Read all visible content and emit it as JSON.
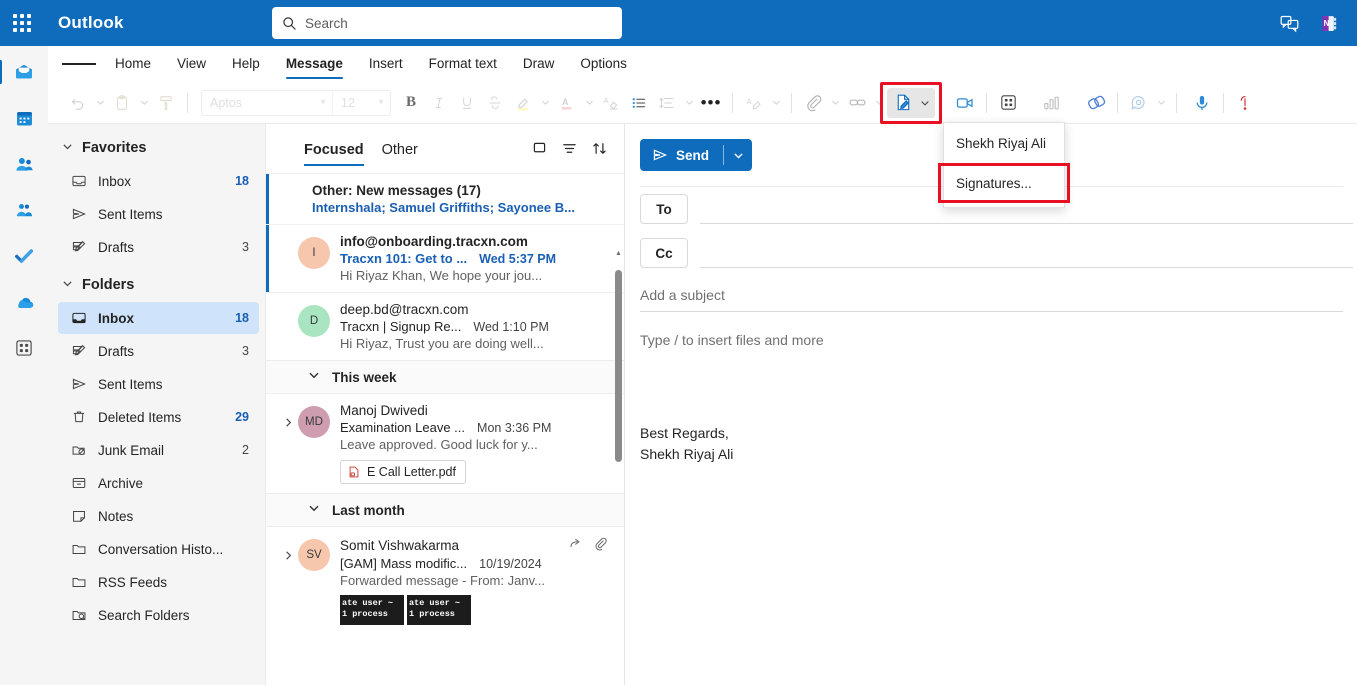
{
  "app": {
    "brand": "Outlook",
    "accent": "#0f6cbd",
    "highlight": "#e81123"
  },
  "search": {
    "placeholder": "Search",
    "value": "",
    "icon": "search-icon"
  },
  "topright": [
    {
      "name": "teams-chat-icon",
      "label": "Teams chat"
    },
    {
      "name": "onenote-icon",
      "label": "OneNote"
    }
  ],
  "rail": [
    {
      "name": "mail",
      "label": "Mail",
      "selected": true
    },
    {
      "name": "calendar",
      "label": "Calendar",
      "selected": false
    },
    {
      "name": "people",
      "label": "People",
      "selected": false
    },
    {
      "name": "teams",
      "label": "Teams",
      "selected": false
    },
    {
      "name": "todo",
      "label": "To Do",
      "selected": false
    },
    {
      "name": "onedrive",
      "label": "OneDrive",
      "selected": false
    },
    {
      "name": "apps",
      "label": "Apps",
      "selected": false
    }
  ],
  "ribbon": {
    "menu_icon": "hamburger-icon",
    "tabs": [
      {
        "label": "Home",
        "active": false
      },
      {
        "label": "View",
        "active": false
      },
      {
        "label": "Help",
        "active": false
      },
      {
        "label": "Message",
        "active": true
      },
      {
        "label": "Insert",
        "active": false
      },
      {
        "label": "Format text",
        "active": false
      },
      {
        "label": "Draw",
        "active": false
      },
      {
        "label": "Options",
        "active": false
      }
    ]
  },
  "toolbar": {
    "font_name": "Aptos",
    "font_size": "12",
    "bold_label": "B",
    "italic_label": "I",
    "underline_label": "U",
    "strike_label": "S",
    "more_label": "•••",
    "items": [
      "undo-icon",
      "paste-icon",
      "format-painter-icon",
      "bold-icon",
      "italic-icon",
      "underline-icon",
      "strikethrough-icon",
      "highlight-icon",
      "font-color-icon",
      "clear-formatting-icon",
      "bullets-icon",
      "line-spacing-icon",
      "more-icon",
      "editor-icon",
      "attach-icon",
      "link-icon",
      "signature-icon",
      "video-icon",
      "apps-icon",
      "poll-icon",
      "loop-icon",
      "viva-icon",
      "dictate-icon",
      "importance-icon"
    ]
  },
  "signature_menu": {
    "items": [
      {
        "label": "Shekh Riyaj Ali",
        "highlighted": false
      },
      {
        "label": "Signatures...",
        "highlighted": true
      }
    ]
  },
  "folders": {
    "groups": [
      {
        "title": "Favorites",
        "items": [
          {
            "label": "Inbox",
            "count": "18",
            "icon": "inbox-icon",
            "selected": false,
            "bold_count": true
          },
          {
            "label": "Sent Items",
            "count": "",
            "icon": "send-icon",
            "selected": false,
            "bold_count": false
          },
          {
            "label": "Drafts",
            "count": "3",
            "icon": "drafts-icon",
            "selected": false,
            "bold_count": false
          }
        ]
      },
      {
        "title": "Folders",
        "items": [
          {
            "label": "Inbox",
            "count": "18",
            "icon": "inbox-icon",
            "selected": true,
            "bold_count": true
          },
          {
            "label": "Drafts",
            "count": "3",
            "icon": "drafts-icon",
            "selected": false,
            "bold_count": false
          },
          {
            "label": "Sent Items",
            "count": "",
            "icon": "send-icon",
            "selected": false,
            "bold_count": false
          },
          {
            "label": "Deleted Items",
            "count": "29",
            "icon": "trash-icon",
            "selected": false,
            "bold_count": true
          },
          {
            "label": "Junk Email",
            "count": "2",
            "icon": "junk-icon",
            "selected": false,
            "bold_count": false
          },
          {
            "label": "Archive",
            "count": "",
            "icon": "archive-icon",
            "selected": false,
            "bold_count": false
          },
          {
            "label": "Notes",
            "count": "",
            "icon": "notes-icon",
            "selected": false,
            "bold_count": false
          },
          {
            "label": "Conversation Histo...",
            "count": "",
            "icon": "folder-icon",
            "selected": false,
            "bold_count": false
          },
          {
            "label": "RSS Feeds",
            "count": "",
            "icon": "folder-icon",
            "selected": false,
            "bold_count": false
          },
          {
            "label": "Search Folders",
            "count": "",
            "icon": "search-folder-icon",
            "selected": false,
            "bold_count": false
          }
        ]
      }
    ]
  },
  "message_list": {
    "pivots": [
      {
        "label": "Focused",
        "active": true
      },
      {
        "label": "Other",
        "active": false
      }
    ],
    "actions": [
      "filter-toggle-icon",
      "filter-icon",
      "sort-icon"
    ],
    "other_summary": {
      "title": "Other: New messages (17)",
      "senders": "Internshala; Samuel Griffiths; Sayonee B..."
    },
    "messages": [
      {
        "sender": "info@onboarding.tracxn.com",
        "subject": "Tracxn 101: Get to ...",
        "time": "Wed 5:37 PM",
        "preview": "Hi Riyaz Khan, We hope your jou...",
        "avatar_initials": "I",
        "avatar_color": "#f6c6ad",
        "unread": true,
        "selected": true
      },
      {
        "sender": "deep.bd@tracxn.com",
        "subject": "Tracxn | Signup Re...",
        "time": "Wed 1:10 PM",
        "preview": "Hi Riyaz, Trust you are doing well...",
        "avatar_initials": "D",
        "avatar_color": "#a9e5c0",
        "unread": false,
        "selected": false
      }
    ],
    "groups": [
      {
        "name": "This week",
        "messages": [
          {
            "sender": "Manoj Dwivedi",
            "subject": "Examination Leave ...",
            "time": "Mon 3:36 PM",
            "preview": "Leave approved. Good luck for y...",
            "avatar_initials": "MD",
            "avatar_color": "#ce9eb0",
            "attachment": "E Call Letter.pdf"
          }
        ]
      },
      {
        "name": "Last month",
        "messages": [
          {
            "sender": "Somit Vishwakarma",
            "subject": "[GAM] Mass modific...",
            "time": "10/19/2024",
            "preview": "Forwarded message - From: Janv...",
            "avatar_initials": "SV",
            "avatar_color": "#f6c6ad",
            "thumbnails": [
              {
                "line1": "ate user ~",
                "line2": " 1 process"
              },
              {
                "line1": "ate user ~",
                "line2": " 1 process"
              }
            ]
          }
        ]
      }
    ]
  },
  "compose": {
    "send_label": "Send",
    "to_label": "To",
    "to_value": "",
    "cc_label": "Cc",
    "cc_value": "",
    "subject_placeholder": "Add a subject",
    "subject_value": "",
    "body_placeholder": "Type / to insert files and more",
    "signature_line1": "Best Regards,",
    "signature_line2": "Shekh Riyaj Ali"
  }
}
